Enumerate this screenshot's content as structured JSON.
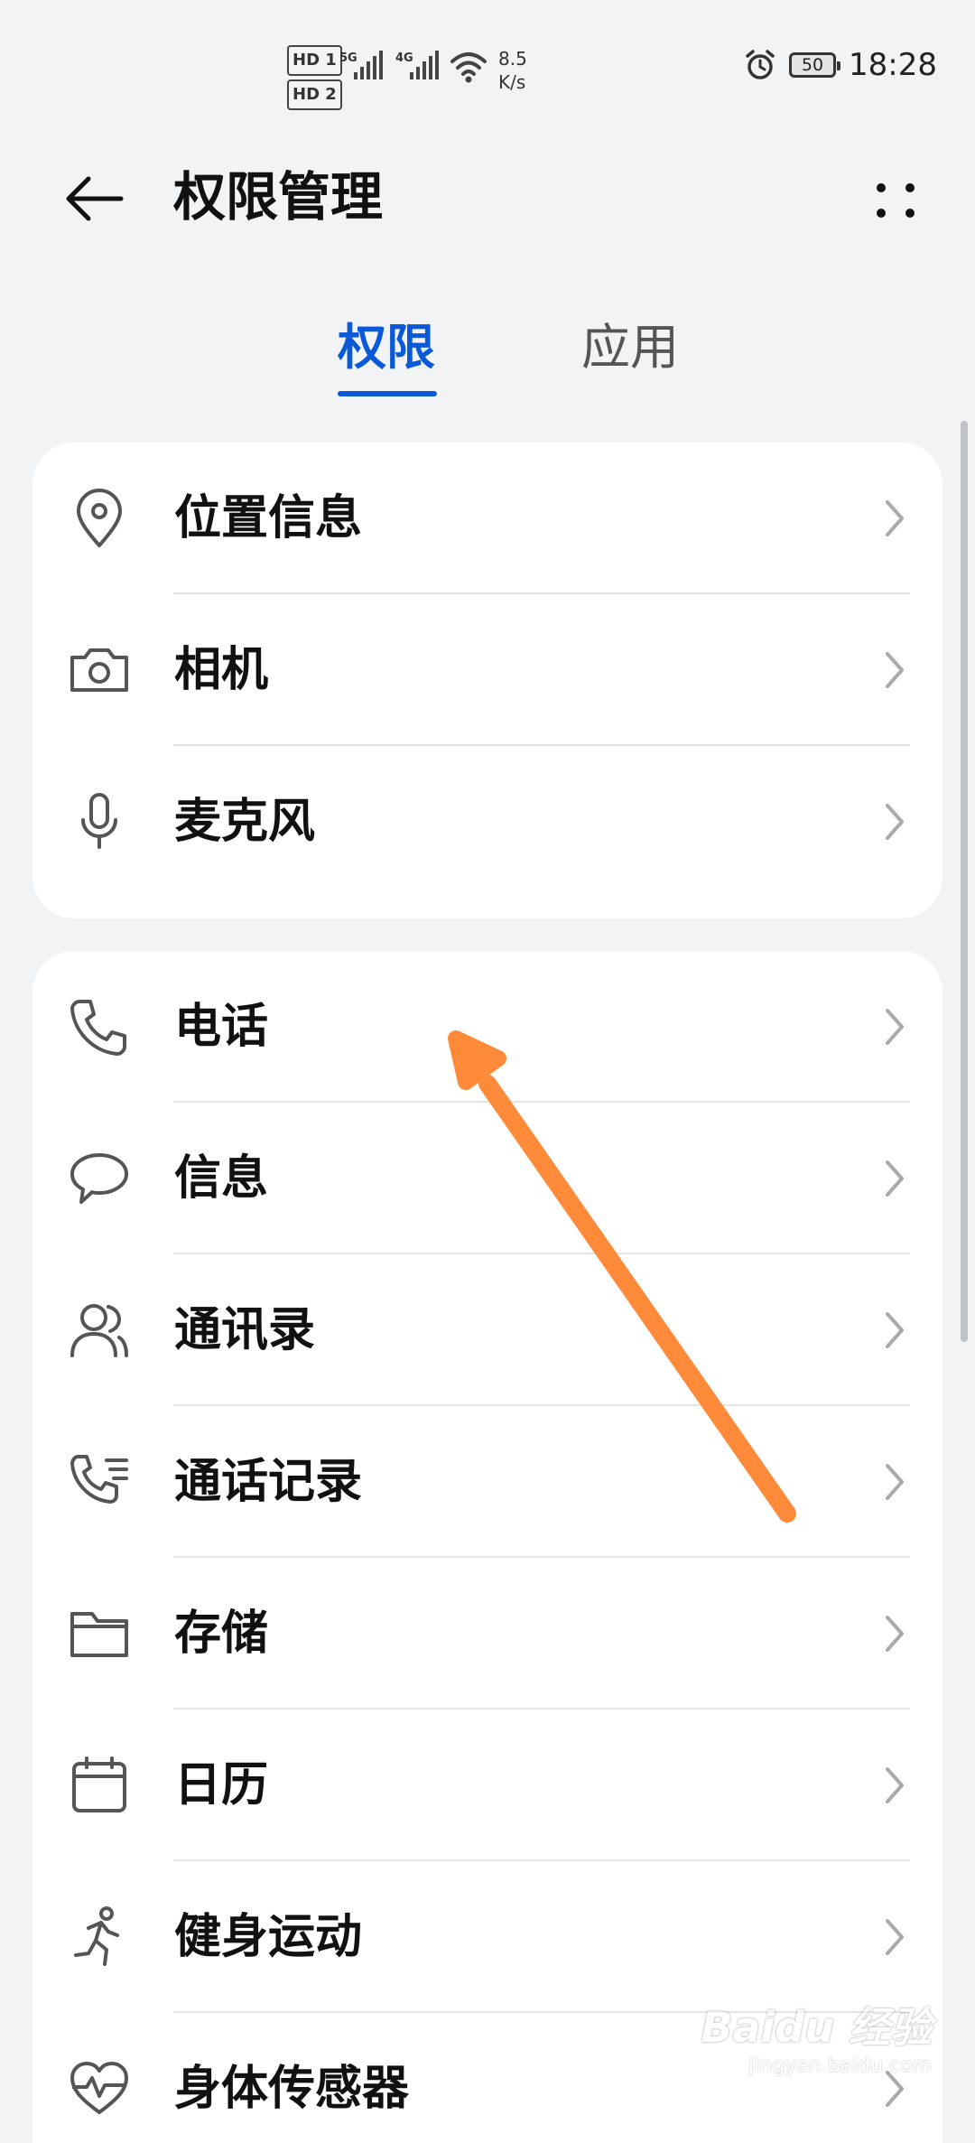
{
  "status_bar": {
    "hd1": "HD 1",
    "hd2": "HD 2",
    "sig1_label": "5G",
    "sig2_label": "4G",
    "speed_value": "8.5",
    "speed_unit": "K/s",
    "battery": "50",
    "time": "18:28"
  },
  "header": {
    "title": "权限管理"
  },
  "tabs": {
    "permissions": "权限",
    "apps": "应用"
  },
  "group1": [
    {
      "label": "位置信息",
      "icon": "location-icon"
    },
    {
      "label": "相机",
      "icon": "camera-icon"
    },
    {
      "label": "麦克风",
      "icon": "microphone-icon"
    }
  ],
  "group2": [
    {
      "label": "电话",
      "icon": "phone-icon"
    },
    {
      "label": "信息",
      "icon": "message-icon"
    },
    {
      "label": "通讯录",
      "icon": "contacts-icon"
    },
    {
      "label": "通话记录",
      "icon": "call-log-icon"
    },
    {
      "label": "存储",
      "icon": "folder-icon"
    },
    {
      "label": "日历",
      "icon": "calendar-icon"
    },
    {
      "label": "健身运动",
      "icon": "running-icon"
    },
    {
      "label": "身体传感器",
      "icon": "heart-rate-icon"
    }
  ],
  "colors": {
    "accent": "#0a59d8",
    "background": "#f1f3f5",
    "annotation_arrow": "#ff8a3a"
  },
  "watermark": {
    "main": "Baidu 经验",
    "sub": "jingyan.baidu.com"
  }
}
